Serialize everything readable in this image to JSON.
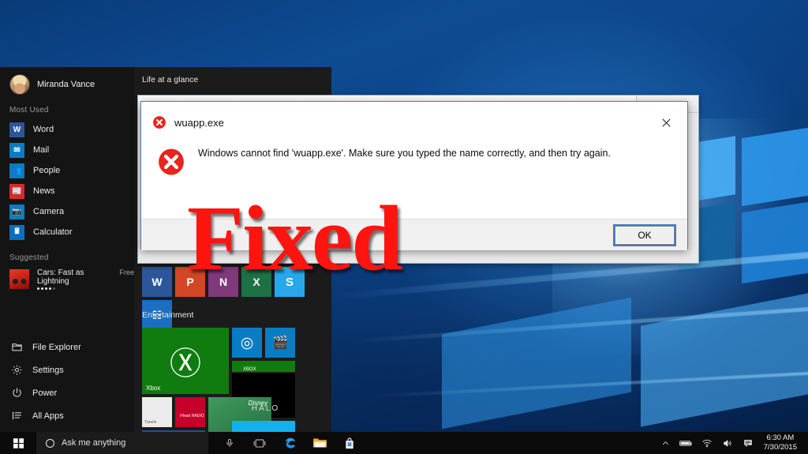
{
  "desktop": {
    "wallpaper_name": "windows-10-hero-logo",
    "background_color": "#0a3f80",
    "accent_color": "#1e7fd4"
  },
  "start_menu": {
    "user": {
      "name": "Miranda Vance",
      "avatar_icon": "user-avatar"
    },
    "sections": {
      "most_used_label": "Most Used",
      "suggested_label": "Suggested"
    },
    "most_used": [
      {
        "label": "Word",
        "icon": "word-icon",
        "color": "#2b579a",
        "glyph": "W"
      },
      {
        "label": "Mail",
        "icon": "mail-icon",
        "color": "#0a7cc4",
        "glyph": "✉"
      },
      {
        "label": "People",
        "icon": "people-icon",
        "color": "#0a7cc4",
        "glyph": "👥"
      },
      {
        "label": "News",
        "icon": "news-icon",
        "color": "#d62b2b",
        "glyph": "📰"
      },
      {
        "label": "Camera",
        "icon": "camera-icon",
        "color": "#0a7cc4",
        "glyph": "📷"
      },
      {
        "label": "Calculator",
        "icon": "calculator-icon",
        "color": "#0a6fbf",
        "glyph": "🖩"
      }
    ],
    "suggested": {
      "name": "Cars: Fast as Lightning",
      "price": "Free",
      "rating": 4,
      "rating_max": 5,
      "thumb_icon": "cars-app-icon"
    },
    "bottom_items": [
      {
        "label": "File Explorer",
        "icon": "folder-icon"
      },
      {
        "label": "Settings",
        "icon": "gear-icon"
      },
      {
        "label": "Power",
        "icon": "power-icon"
      },
      {
        "label": "All Apps",
        "icon": "list-icon"
      }
    ],
    "tile_groups": [
      {
        "title": "Life at a glance",
        "tiles": [
          {
            "label": "",
            "icon": "word-tile",
            "color": "#2b579a",
            "size": "sm",
            "glyph": "W"
          },
          {
            "label": "",
            "icon": "powerpoint-tile",
            "color": "#d24726",
            "size": "sm",
            "glyph": "P"
          },
          {
            "label": "",
            "icon": "onenote-tile",
            "color": "#80397b",
            "size": "sm",
            "glyph": "N"
          },
          {
            "label": "",
            "icon": "excel-tile",
            "color": "#1e7145",
            "size": "sm",
            "glyph": "X"
          },
          {
            "label": "",
            "icon": "skype-tile",
            "color": "#28a8ea",
            "size": "sm",
            "glyph": "S"
          },
          {
            "label": "",
            "icon": "calendar-tile",
            "color": "#1b6ec2",
            "size": "sm",
            "glyph": "☷"
          }
        ]
      },
      {
        "title": "Entertainment",
        "tiles": [
          {
            "label": "Xbox",
            "icon": "xbox-tile",
            "color": "#107c10",
            "size": "lg",
            "glyph": "Ⓧ"
          },
          {
            "label": "",
            "icon": "groove-music-tile",
            "color": "#0a7cc4",
            "size": "sm",
            "glyph": "◎"
          },
          {
            "label": "",
            "icon": "movies-tv-tile",
            "color": "#0a7cc4",
            "size": "sm",
            "glyph": "🎬"
          },
          {
            "label": "XBOX",
            "icon": "xbox-banner-tile",
            "color": "#107c10",
            "size": "banner",
            "glyph": "Ⓧ"
          },
          {
            "label": "HALO",
            "icon": "halo-tile",
            "color": "#000000",
            "size": "md",
            "glyph": "▲"
          },
          {
            "label": "TuneIn",
            "icon": "tunein-tile",
            "color": "#ebebeb",
            "size": "sm",
            "glyph": "◉"
          },
          {
            "label": "iHeart RADIO",
            "icon": "iheartradio-tile",
            "color": "#c6002b",
            "size": "sm",
            "glyph": "♥"
          },
          {
            "label": "Disney",
            "icon": "disney-frozen-tile",
            "color": "#2f8f4f",
            "size": "md",
            "glyph": "❄"
          },
          {
            "label": "",
            "icon": "popcorn-tile",
            "color": "#18529e",
            "size": "sm",
            "glyph": "🍿"
          },
          {
            "label": "",
            "icon": "flipboard-tile",
            "color": "#12b0f0",
            "size": "sm",
            "glyph": "■"
          }
        ]
      }
    ]
  },
  "dialog": {
    "title": "wuapp.exe",
    "title_icon": "error-icon",
    "body_icon": "error-icon-large",
    "message": "Windows cannot find 'wuapp.exe'. Make sure you typed the name correctly, and then try again.",
    "ok_label": "OK",
    "close_icon": "close-icon",
    "error_color": "#e8241c",
    "focus_color": "#3a7fd5"
  },
  "overlay": {
    "text": "Fixed",
    "color": "#ff1410"
  },
  "taskbar": {
    "start_icon": "windows-start-icon",
    "search": {
      "placeholder": "Ask me anything",
      "cortana_icon": "cortana-circle-icon",
      "mic_icon": "microphone-icon"
    },
    "pinned": [
      {
        "name": "task-view",
        "icon": "task-view-icon",
        "glyph": "❐"
      },
      {
        "name": "edge",
        "icon": "edge-icon",
        "glyph": "e"
      },
      {
        "name": "file-explorer",
        "icon": "folder-icon",
        "glyph": "📁"
      },
      {
        "name": "store",
        "icon": "store-icon",
        "glyph": "🛍"
      }
    ],
    "tray": [
      {
        "name": "show-hidden-icons",
        "icon": "chevron-up-icon",
        "glyph": "⌃"
      },
      {
        "name": "battery",
        "icon": "battery-icon",
        "glyph": "▭"
      },
      {
        "name": "network",
        "icon": "wifi-icon",
        "glyph": "◠"
      },
      {
        "name": "volume",
        "icon": "speaker-icon",
        "glyph": "🔊"
      },
      {
        "name": "action-center",
        "icon": "notification-icon",
        "glyph": "💬"
      }
    ],
    "clock": {
      "time": "6:30 AM",
      "date": "7/30/2015"
    }
  }
}
